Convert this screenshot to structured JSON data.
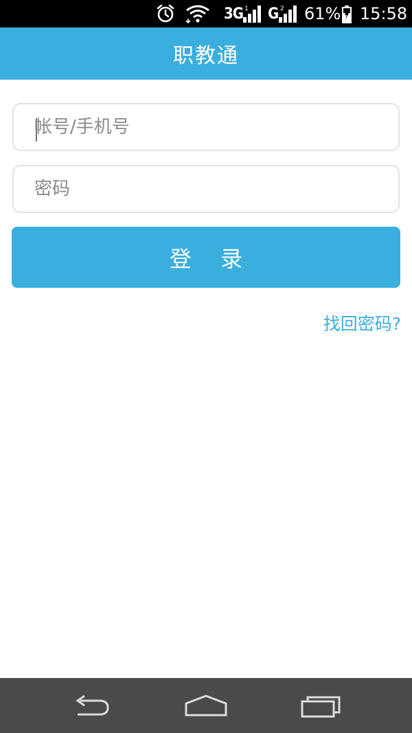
{
  "status_bar": {
    "network_1": "3G",
    "network_2": "G",
    "battery_percent": "61%",
    "time": "15:58",
    "icons": [
      "alarm-icon",
      "wifi-icon",
      "signal-icon",
      "signal-icon",
      "battery-charging-icon"
    ]
  },
  "app": {
    "title": "职教通"
  },
  "login_form": {
    "account_placeholder": "帐号/手机号",
    "account_value": "",
    "password_placeholder": "密码",
    "password_value": "",
    "login_label": "登 录",
    "forgot_label": "找回密码?"
  },
  "nav_bar": {
    "icons": [
      "back-icon",
      "home-icon",
      "recent-apps-icon"
    ]
  },
  "colors": {
    "accent": "#3aaede",
    "status_bar": "#000000",
    "nav_bar": "#4a4a4a",
    "field_border": "#e2e2e2"
  }
}
